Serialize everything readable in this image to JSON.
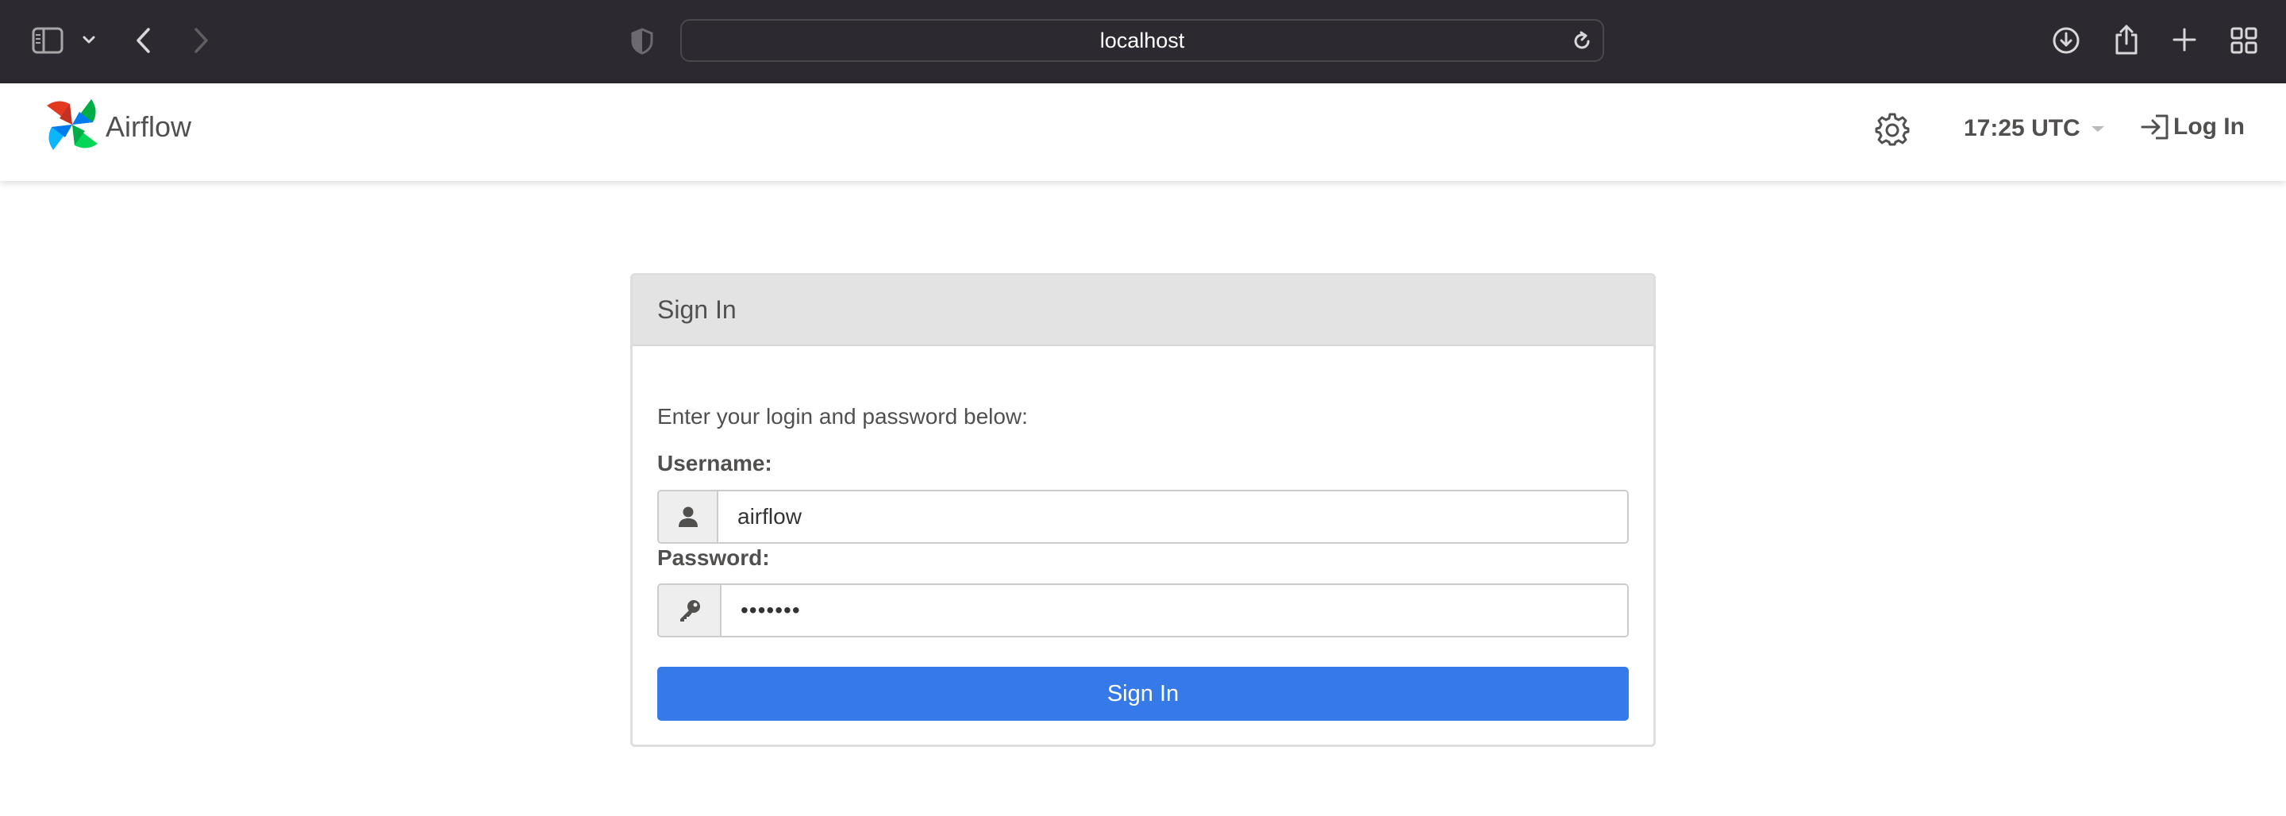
{
  "browser": {
    "url": "localhost",
    "icons": {
      "sidebar": "sidebar-icon",
      "sidebar_menu": "chevron-down-icon",
      "back": "chevron-left-icon",
      "forward": "chevron-right-icon",
      "privacy": "shield-icon",
      "reload": "reload-icon",
      "downloads": "download-icon",
      "share": "share-icon",
      "new_tab": "plus-icon",
      "tab_overview": "grid-icon"
    }
  },
  "navbar": {
    "brand": "Airflow",
    "time": "17:25 UTC",
    "login_label": "Log In",
    "icons": {
      "logo": "airflow-pinwheel-logo",
      "settings": "gear-icon",
      "login": "sign-in-icon",
      "time_menu": "caret-down-icon"
    }
  },
  "login_form": {
    "title": "Sign In",
    "instructions": "Enter your login and password below:",
    "username_label": "Username:",
    "username_value": "airflow",
    "password_label": "Password:",
    "password_value": "•••••••",
    "submit_label": "Sign In",
    "icons": {
      "username": "user-icon",
      "password": "key-icon"
    }
  },
  "colors": {
    "chrome_bg": "#2c2a30",
    "primary": "#357ae8",
    "panel_heading": "#e3e3e3",
    "text": "#51504f"
  }
}
